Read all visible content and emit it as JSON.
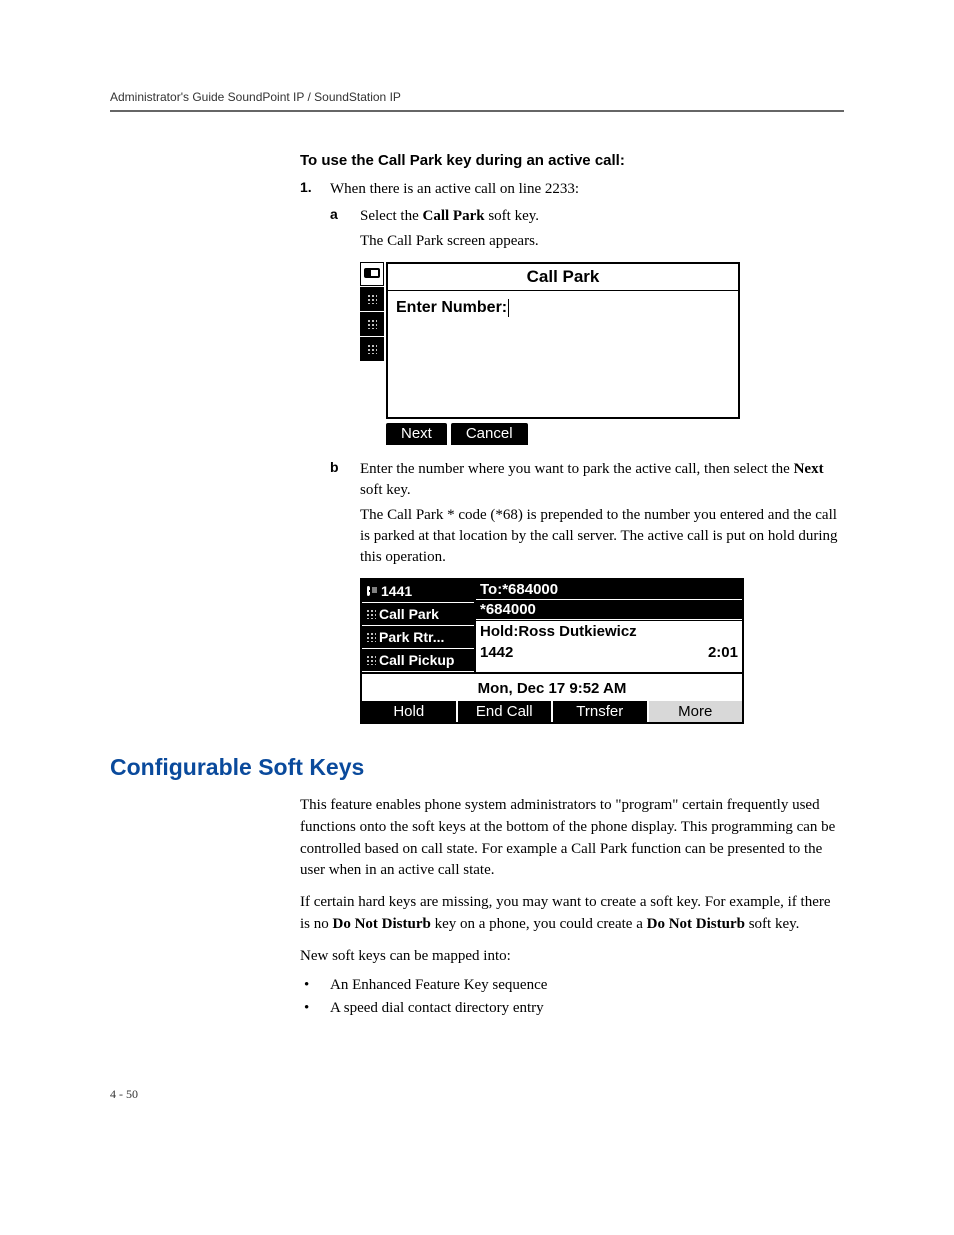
{
  "header": "Administrator's Guide SoundPoint IP / SoundStation IP",
  "section_a": {
    "heading": "To use the Call Park key during an active call:",
    "step1_num": "1.",
    "step1_text": "When there is an active call on line 2233:",
    "a_marker": "a",
    "a_text_pre": "Select the ",
    "a_text_strong": "Call Park",
    "a_text_post": " soft key.",
    "a_result": "The Call Park screen appears.",
    "b_marker": "b",
    "b_text_pre": "Enter the number where you want to park the active call, then select the ",
    "b_text_strong": "Next",
    "b_text_post": " soft key.",
    "b_result": "The Call Park * code (*68) is prepended to the number you entered and the call is parked at that location by the call server. The active call is put on hold during this operation."
  },
  "phone1": {
    "title": "Call Park",
    "prompt": "Enter Number:",
    "sk_next": "Next",
    "sk_cancel": "Cancel"
  },
  "phone2": {
    "line_ext": "1441",
    "line_callpark": "Call Park",
    "line_parkrtr": "Park Rtr...",
    "line_callpickup": "Call Pickup",
    "to": "To:*684000",
    "num": "*684000",
    "hold": "Hold:Ross Dutkiewicz",
    "hold_ext": "1442",
    "timer": "2:01",
    "datetime": "Mon, Dec 17  9:52 AM",
    "sk_hold": "Hold",
    "sk_endcall": "End Call",
    "sk_trnsfer": "Trnsfer",
    "sk_more": "More"
  },
  "softkeys_section": {
    "title": "Configurable Soft Keys",
    "p1": "This feature enables phone system administrators to \"program\" certain frequently used functions onto the soft keys at the bottom of the phone display. This programming can be controlled based on call state. For example a Call Park function can be presented to the user when in an active call state.",
    "p2_pre": "If certain hard keys are missing, you may want to create a soft key. For example, if there is no ",
    "p2_s1": "Do Not Disturb",
    "p2_mid": " key on a phone, you could create a ",
    "p2_s2": "Do Not Disturb",
    "p2_post": " soft key.",
    "p3": "New soft keys can be mapped into:",
    "b1": "An Enhanced Feature Key sequence",
    "b2": "A speed dial contact directory entry"
  },
  "page_num": "4 - 50"
}
